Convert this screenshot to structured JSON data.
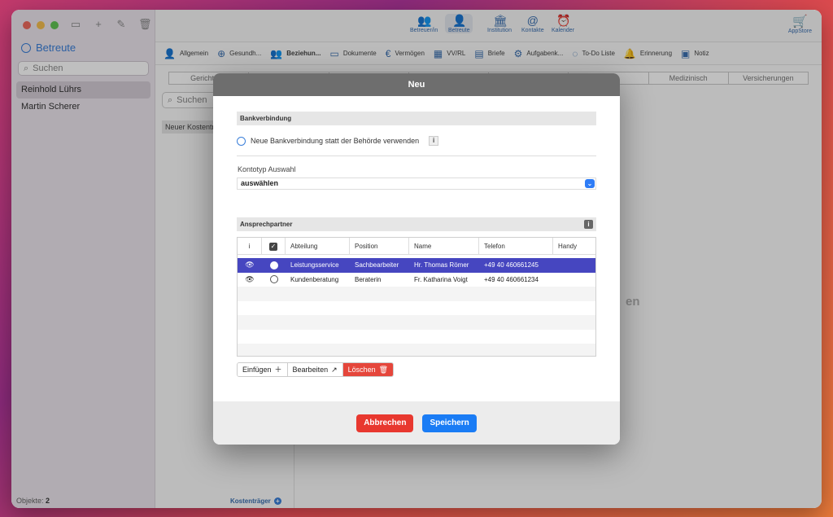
{
  "sidebar": {
    "title": "Betreute",
    "search_placeholder": "Suchen",
    "items": [
      {
        "label": "Reinhold Lührs",
        "selected": true
      },
      {
        "label": "Martin Scherer",
        "selected": false
      }
    ],
    "footer_label": "Objekte:",
    "footer_count": "2"
  },
  "toolbar": {
    "buttons": [
      {
        "label": "Betreuer/in",
        "icon": "person-group-icon"
      },
      {
        "label": "Betreute",
        "icon": "person-icon"
      },
      {
        "label": "Institution",
        "icon": "building-icon"
      },
      {
        "label": "Kontakte",
        "icon": "at-icon"
      },
      {
        "label": "Kalender",
        "icon": "alarm-icon"
      }
    ],
    "appstore_label": "AppStore"
  },
  "tabs": [
    {
      "label": "Allgemein",
      "icon": "person-outline-icon"
    },
    {
      "label": "Gesundh...",
      "icon": "medical-box-icon"
    },
    {
      "label": "Beziehun...",
      "icon": "people-icon"
    },
    {
      "label": "Dokumente",
      "icon": "folder-icon"
    },
    {
      "label": "Vermögen",
      "icon": "euro-icon"
    },
    {
      "label": "VV/RL",
      "icon": "grid-icon"
    },
    {
      "label": "Briefe",
      "icon": "document-icon"
    },
    {
      "label": "Aufgabenk...",
      "icon": "gear-check-icon"
    },
    {
      "label": "To-Do Liste",
      "icon": "circle-check-icon"
    },
    {
      "label": "Erinnerung",
      "icon": "bell-icon"
    },
    {
      "label": "Notiz",
      "icon": "note-icon"
    }
  ],
  "segments": [
    "Gericht, Be",
    "",
    "",
    "",
    "",
    "",
    "Medizinisch",
    "Versicherungen"
  ],
  "sub_search_placeholder": "Suchen",
  "sub_item": "Neuer Kostentr",
  "kostentraeger_label": "Kostenträger",
  "ghost_text": "en",
  "dialog": {
    "title": "Neu",
    "bank_section": "Bankverbindung",
    "radio_label": "Neue Bankverbindung statt der Behörde verwenden",
    "kontotyp_label": "Kontotyp Auswahl",
    "kontotyp_value": "auswählen",
    "contact_section": "Ansprechpartner",
    "columns": [
      "i",
      "",
      "Abteilung",
      "Position",
      "Name",
      "Telefon",
      "Handy"
    ],
    "rows": [
      {
        "abteilung": "Leistungsservice",
        "position": "Sachbearbeiter",
        "name": "Hr. Thomas Römer",
        "telefon": "+49 40 460661245",
        "handy": "",
        "selected": true
      },
      {
        "abteilung": "Kundenberatung",
        "position": "Beraterin",
        "name": "Fr. Katharina Voigt",
        "telefon": "+49 40 460661234",
        "handy": "",
        "selected": false
      }
    ],
    "buttons": {
      "insert": "Einfügen",
      "edit": "Bearbeiten",
      "delete": "Löschen"
    },
    "cancel": "Abbrechen",
    "save": "Speichern"
  },
  "colors": {
    "accent": "#3a7fd9",
    "selection": "#4646c0",
    "danger": "#e8382f",
    "primary": "#1a7cf5"
  }
}
